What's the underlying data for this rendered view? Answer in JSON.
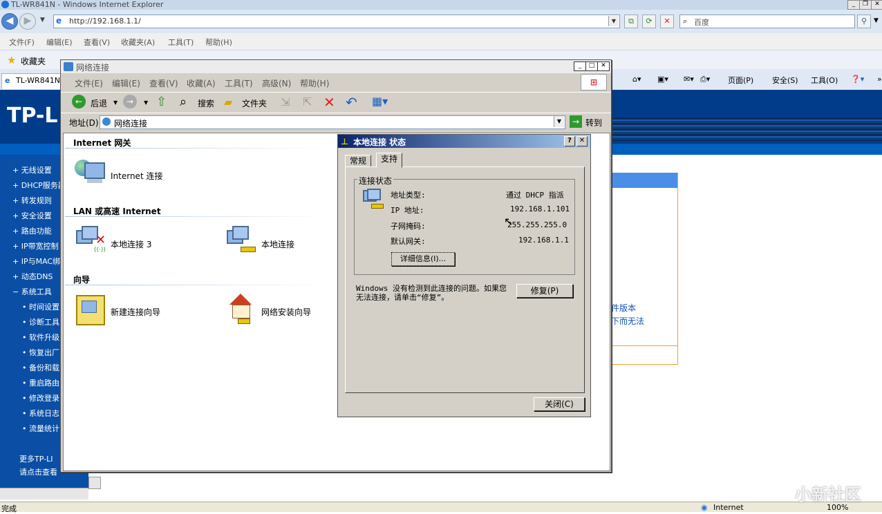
{
  "ie": {
    "title": "TL-WR841N - Windows Internet Explorer",
    "url": "http://192.168.1.1/",
    "search_placeholder": "百度",
    "menu": [
      "文件(F)",
      "编辑(E)",
      "查看(V)",
      "收藏夹(A)",
      "工具(T)",
      "帮助(H)"
    ],
    "favorites": "收藏夹",
    "tab": "TL-WR841N",
    "commands": {
      "page": "页面(P)",
      "safety": "安全(S)",
      "tools": "工具(O)"
    },
    "status_left": "完成",
    "status_zone": "Internet",
    "zoom": "100%"
  },
  "router": {
    "logo": "TP-L",
    "menu": [
      "无线设置",
      "DHCP服务器",
      "转发规则",
      "安全设置",
      "路由功能",
      "IP带宽控制",
      "IP与MAC绑",
      "动态DNS",
      "系统工具"
    ],
    "submenu": [
      "时间设置",
      "诊断工具",
      "软件升级",
      "恢复出厂",
      "备份和载",
      "重启路由",
      "修改登录",
      "系统日志",
      "流量统计"
    ],
    "more1": "更多TP-LI",
    "more2": "请点击查看",
    "panel_text1": "件版本",
    "panel_text2": "下而无法"
  },
  "nc": {
    "title": "网络连接",
    "menu": [
      "文件(E)",
      "编辑(E)",
      "查看(V)",
      "收藏(A)",
      "工具(T)",
      "高级(N)",
      "帮助(H)"
    ],
    "toolbar": {
      "back": "后退",
      "search": "搜索",
      "folders": "文件夹"
    },
    "address_label": "地址(D)",
    "address_value": "网络连接",
    "go": "转到",
    "groups": {
      "internet": "Internet 网关",
      "lan": "LAN 或高速 Internet",
      "wizard": "向导"
    },
    "items": {
      "internet_conn": "Internet 连接",
      "local3": "本地连接 3",
      "local": "本地连接",
      "new_wizard": "新建连接向导",
      "home_wizard": "网络安装向导"
    }
  },
  "status": {
    "title": "本地连接 状态",
    "tabs": [
      "常规",
      "支持"
    ],
    "group": "连接状态",
    "rows": [
      {
        "label": "地址类型:",
        "value": "通过 DHCP 指派"
      },
      {
        "label": "IP 地址:",
        "value": "192.168.1.101"
      },
      {
        "label": "子网掩码:",
        "value": "255.255.255.0"
      },
      {
        "label": "默认网关:",
        "value": "192.168.1.1"
      }
    ],
    "details_btn": "详细信息(I)...",
    "message": "Windows 没有检测到此连接的问题。如果您无法连接，请单击“修复”。",
    "repair_btn": "修复(P)",
    "close_btn": "关闭(C)"
  },
  "watermark": "小新社区"
}
